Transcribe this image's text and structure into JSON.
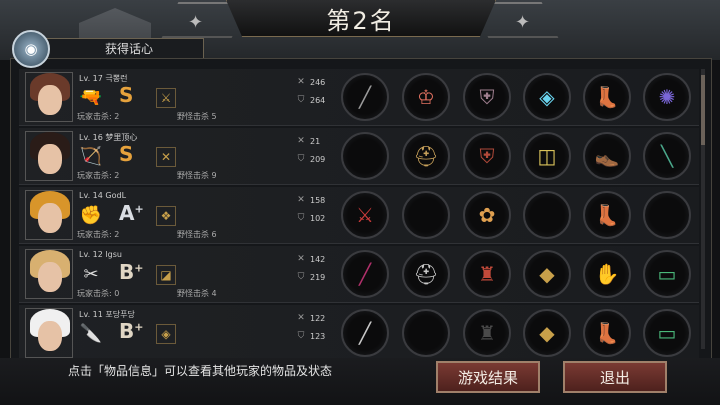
{
  "title": "第2名",
  "tab_label": "获得话心",
  "hint_text": "点击「物品信息」可以查看其他玩家的物品及状态",
  "buttons": {
    "result": "游戏结果",
    "exit": "退出"
  },
  "colors": {
    "grade_s": "#e6a23c",
    "grade_a": "#d9dde2",
    "grade_b": "#e0d6c4",
    "button": "#6a2f29"
  },
  "players": [
    {
      "level": "Lv. 17",
      "name": "극뽕런",
      "weapon_icon": "pistol-icon",
      "weapon_glyph": "🔫",
      "grade": "S",
      "grade_sup": "",
      "skill_icon": "crossed-swords-icon",
      "skill_glyph": "⚔",
      "kills_player": "玩家击杀: 2",
      "kills_monster": "野怪击杀 5",
      "attack": "246",
      "defense": "264",
      "items": [
        "sniper-rifle-icon",
        "horned-helm-icon",
        "gauntlet-armor-icon",
        "blue-crystal-bracer-icon",
        "armored-greaves-icon",
        "galaxy-accessory-icon"
      ],
      "item_glyphs": [
        "╱",
        "♔",
        "⛨",
        "◈",
        "👢",
        "✺"
      ],
      "item_colors": [
        "#9a9a9a",
        "#e07060",
        "#a08090",
        "#6ad4ef",
        "#999",
        "#7a66d8"
      ]
    },
    {
      "level": "Lv. 16",
      "name": "梦里顶心",
      "weapon_icon": "crossbow-icon",
      "weapon_glyph": "🏹",
      "grade": "S",
      "grade_sup": "",
      "skill_icon": "crossed-sticks-icon",
      "skill_glyph": "✕",
      "kills_player": "玩家击杀: 2",
      "kills_monster": "野怪击杀 9",
      "attack": "21",
      "defense": "209",
      "items": [
        "empty-slot-icon",
        "golden-helmet-icon",
        "red-armor-icon",
        "gold-bracer-icon",
        "leather-boots-icon",
        "club-icon"
      ],
      "item_glyphs": [
        "",
        "⛑",
        "⛨",
        "◫",
        "👞",
        "╲"
      ],
      "item_colors": [
        "#999",
        "#c7a05a",
        "#b24a3a",
        "#d9c25a",
        "#8a6a4a",
        "#4aa78a"
      ]
    },
    {
      "level": "Lv. 14",
      "name": "GodL",
      "weapon_icon": "fist-icon",
      "weapon_glyph": "✊",
      "grade": "A",
      "grade_sup": "+",
      "skill_icon": "purple-beast-icon",
      "skill_glyph": "❖",
      "kills_player": "玩家击杀: 2",
      "kills_monster": "野怪击杀 6",
      "attack": "158",
      "defense": "102",
      "items": [
        "red-blade-weapon-icon",
        "empty-slot-icon",
        "flower-armor-icon",
        "empty-slot-icon",
        "black-boots-icon",
        "empty-slot-icon"
      ],
      "item_glyphs": [
        "⚔",
        "",
        "✿",
        "",
        "👢",
        ""
      ],
      "item_colors": [
        "#c83a3a",
        "#999",
        "#e0a050",
        "#999",
        "#555",
        "#999"
      ]
    },
    {
      "level": "Lv. 12",
      "name": "lgsu",
      "weapon_icon": "dual-blades-icon",
      "weapon_glyph": "✂",
      "grade": "B",
      "grade_sup": "+",
      "skill_icon": "gold-shard-icon",
      "skill_glyph": "◪",
      "kills_player": "玩家击杀: 0",
      "kills_monster": "野怪击杀 4",
      "attack": "142",
      "defense": "219",
      "items": [
        "crimson-sword-icon",
        "iron-helm-icon",
        "red-coat-icon",
        "gold-arm-guard-icon",
        "gauntlet-icon",
        "green-scope-rifle-icon"
      ],
      "item_glyphs": [
        "╱",
        "⛑",
        "♜",
        "◆",
        "✋",
        "▭"
      ],
      "item_colors": [
        "#b0306a",
        "#c8c8c8",
        "#c24a3a",
        "#c8a04a",
        "#b87a5a",
        "#4ab87a"
      ]
    },
    {
      "level": "Lv. 11",
      "name": "포당푸당",
      "weapon_icon": "knife-icon",
      "weapon_glyph": "🔪",
      "grade": "B",
      "grade_sup": "+",
      "skill_icon": "green-emerald-icon",
      "skill_glyph": "◈",
      "kills_player": "",
      "kills_monster": "",
      "attack": "122",
      "defense": "123",
      "items": [
        "katana-icon",
        "empty-slot-icon",
        "dark-jacket-icon",
        "gold-arm-guard-icon",
        "black-boots-icon",
        "green-scope-rifle-icon"
      ],
      "item_glyphs": [
        "╱",
        "",
        "♜",
        "◆",
        "👢",
        "▭"
      ],
      "item_colors": [
        "#c8c8c8",
        "#999",
        "#4a4a4a",
        "#c8a04a",
        "#555",
        "#4ab87a"
      ]
    }
  ]
}
